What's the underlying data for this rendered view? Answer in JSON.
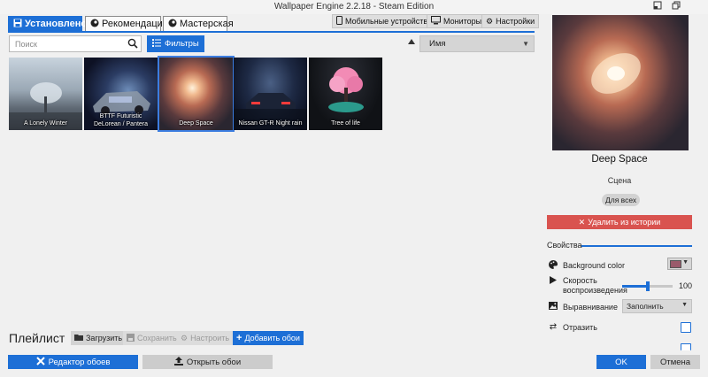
{
  "window": {
    "title": "Wallpaper Engine 2.2.18 - Steam Edition",
    "dock_icon": "dock-icon",
    "restore_icon": "restore-icon"
  },
  "tabs": [
    {
      "label": "Установлено",
      "icon": "save-icon",
      "active": true
    },
    {
      "label": "Рекомендации",
      "icon": "steam-icon",
      "active": false
    },
    {
      "label": "Мастерская",
      "icon": "steam-icon",
      "active": false
    }
  ],
  "top_buttons": {
    "mobile": "Мобильные устройства",
    "monitors": "Мониторы",
    "settings": "Настройки"
  },
  "search": {
    "placeholder": "Поиск",
    "value": ""
  },
  "filters_label": "Фильтры",
  "sort": {
    "selected": "Имя"
  },
  "wallpapers": [
    {
      "title": "A Lonely Winter",
      "selected": false
    },
    {
      "title": "BTTF Futuristic DeLorean / Pantera",
      "selected": false
    },
    {
      "title": "Deep Space",
      "selected": true
    },
    {
      "title": "Nissan GT-R Night rain",
      "selected": false
    },
    {
      "title": "Tree of life",
      "selected": false
    }
  ],
  "playlist": {
    "title": "Плейлист",
    "load": "Загрузить",
    "save": "Сохранить",
    "configure": "Настроить",
    "add": "Добавить обои"
  },
  "bottom": {
    "editor": "Редактор обоев",
    "open": "Открыть обои"
  },
  "details": {
    "name": "Deep Space",
    "type": "Сцена",
    "rating": "Для всех",
    "delete": "Удалить из истории",
    "properties_title": "Свойства",
    "properties": {
      "bg_color_label": "Background color",
      "bg_color_value": "#9a5a6b",
      "speed_label_1": "Скорость",
      "speed_label_2": "воспроизведения",
      "speed_value": "100",
      "speed_fraction": 0.5,
      "align_label": "Выравнивание",
      "align_value": "Заполнить",
      "flip_label": "Отразить"
    }
  },
  "dialog": {
    "ok": "OK",
    "cancel": "Отмена"
  },
  "colors": {
    "accent": "#1d6fd6",
    "danger": "#d9534f"
  }
}
